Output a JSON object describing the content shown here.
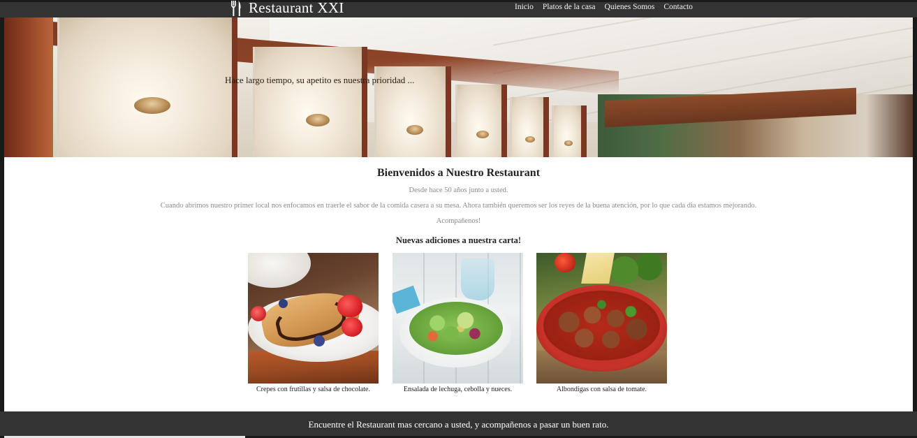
{
  "brand": {
    "name": "Restaurant XXI",
    "icon": "fork-knife-icon"
  },
  "nav": {
    "items": [
      {
        "label": "Inicio"
      },
      {
        "label": "Platos de la casa"
      },
      {
        "label": "Quienes Somos"
      },
      {
        "label": "Contacto"
      }
    ]
  },
  "hero": {
    "caption": "Hace largo tiempo, su apetito es nuestra prioridad ..."
  },
  "main": {
    "title": "Bienvenidos a Nuestro Restaurant",
    "subtitle": "Desde hace 50 años junto a usted.",
    "paragraph": "Cuando abrimos nuestro primer local nos enfocamos en traerle el sabor de la comida casera a su mesa. Ahora también queremos ser los reyes de la buena atención, por lo que cada dia estamos mejorando.",
    "join": "Acompañenos!",
    "new_items_title": "Nuevas adiciones a nuestra carta!",
    "dishes": [
      {
        "caption": "Crepes con frutillas y salsa de chocolate."
      },
      {
        "caption": "Ensalada de lechuga, cebolla y nueces."
      },
      {
        "caption": "Albondigas con salsa de tomate."
      }
    ]
  },
  "footer": {
    "text": "Encuentre el Restaurant mas cercano a usted, y acompañenos a pasar un buen rato."
  },
  "colors": {
    "nav_bg": "#333333",
    "footer_bg": "#333333",
    "body_bg": "#ffffff",
    "muted_text": "#8a8a8a"
  }
}
